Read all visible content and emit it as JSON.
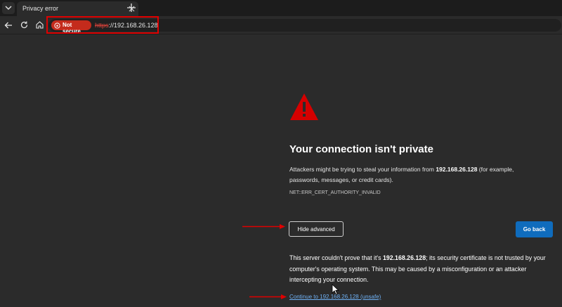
{
  "tab": {
    "title": "Privacy error"
  },
  "address_bar": {
    "security_label": "Not secure",
    "url_scheme": "https",
    "url_rest": "://192.168.26.128"
  },
  "page": {
    "title": "Your connection isn't private",
    "desc_prefix": "Attackers might be trying to steal your information from ",
    "host": "192.168.26.128",
    "desc_suffix": " (for example, passwords, messages, or credit cards).",
    "error_code": "NET::ERR_CERT_AUTHORITY_INVALID",
    "hide_advanced_label": "Hide advanced",
    "go_back_label": "Go back",
    "advanced_prefix": "This server couldn't prove that it's ",
    "advanced_suffix": "; its security certificate is not trusted by your computer's operating system. This may be caused by a misconfiguration or an attacker intercepting your connection.",
    "proceed_link": "Continue to 192.168.26.128 (unsafe)"
  },
  "colors": {
    "not_secure": "#c42b1c",
    "warning_icon": "#d50000",
    "annotation": "#e00000",
    "go_back": "#0f6cbd",
    "link": "#6fb1f5"
  },
  "icons": [
    "chevron-down-icon",
    "close-icon",
    "plus-icon",
    "back-arrow-icon",
    "refresh-icon",
    "home-icon",
    "not-secure-icon",
    "warning-icon",
    "mouse-cursor-icon"
  ]
}
